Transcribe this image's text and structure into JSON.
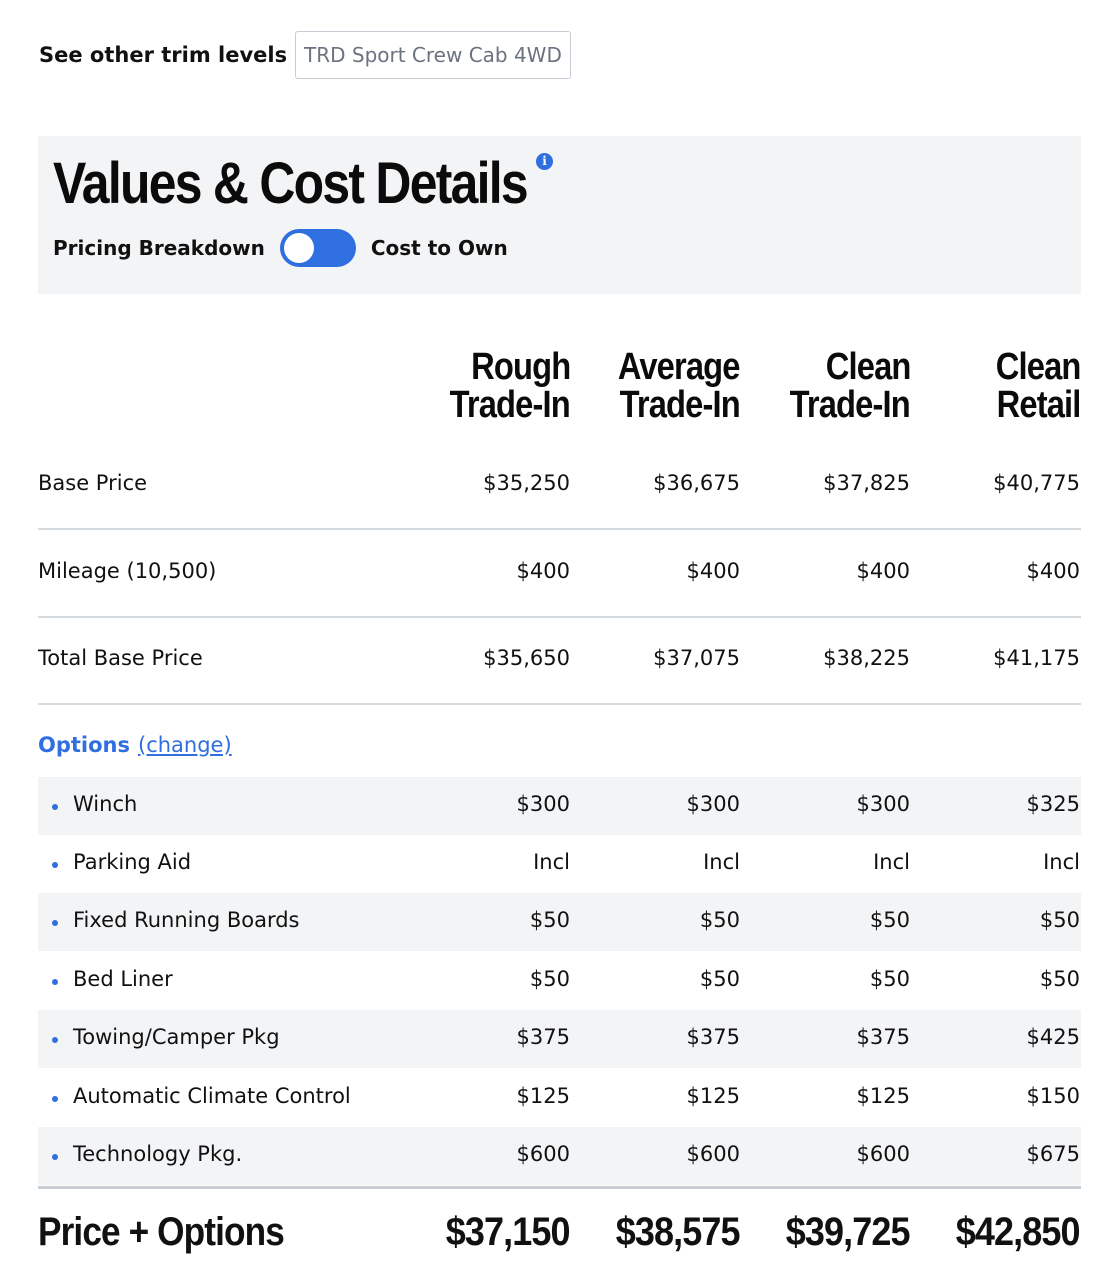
{
  "trim": {
    "label": "See other trim levels",
    "selected": "TRD Sport Crew Cab 4WD"
  },
  "header": {
    "title": "Values & Cost Details",
    "info_icon": "info-icon",
    "toggle_left": "Pricing Breakdown",
    "toggle_right": "Cost to Own",
    "toggle_color": "#2f6fe0"
  },
  "columns": [
    {
      "line1": "Rough",
      "line2": "Trade-In"
    },
    {
      "line1": "Average",
      "line2": "Trade-In"
    },
    {
      "line1": "Clean",
      "line2": "Trade-In"
    },
    {
      "line1": "Clean",
      "line2": "Retail"
    }
  ],
  "rows": [
    {
      "label": "Base Price",
      "values": [
        "$35,250",
        "$36,675",
        "$37,825",
        "$40,775"
      ]
    },
    {
      "label": "Mileage (10,500)",
      "values": [
        "$400",
        "$400",
        "$400",
        "$400"
      ]
    },
    {
      "label": "Total Base Price",
      "values": [
        "$35,650",
        "$37,075",
        "$38,225",
        "$41,175"
      ]
    }
  ],
  "options": {
    "title": "Options",
    "change_link": "(change)",
    "items": [
      {
        "label": "Winch",
        "values": [
          "$300",
          "$300",
          "$300",
          "$325"
        ]
      },
      {
        "label": "Parking Aid",
        "values": [
          "Incl",
          "Incl",
          "Incl",
          "Incl"
        ]
      },
      {
        "label": "Fixed Running Boards",
        "values": [
          "$50",
          "$50",
          "$50",
          "$50"
        ]
      },
      {
        "label": "Bed Liner",
        "values": [
          "$50",
          "$50",
          "$50",
          "$50"
        ]
      },
      {
        "label": "Towing/Camper Pkg",
        "values": [
          "$375",
          "$375",
          "$375",
          "$425"
        ]
      },
      {
        "label": "Automatic Climate Control",
        "values": [
          "$125",
          "$125",
          "$125",
          "$150"
        ]
      },
      {
        "label": "Technology Pkg.",
        "values": [
          "$600",
          "$600",
          "$600",
          "$675"
        ]
      }
    ]
  },
  "total": {
    "label": "Price + Options",
    "values": [
      "$37,150",
      "$38,575",
      "$39,725",
      "$42,850"
    ]
  }
}
